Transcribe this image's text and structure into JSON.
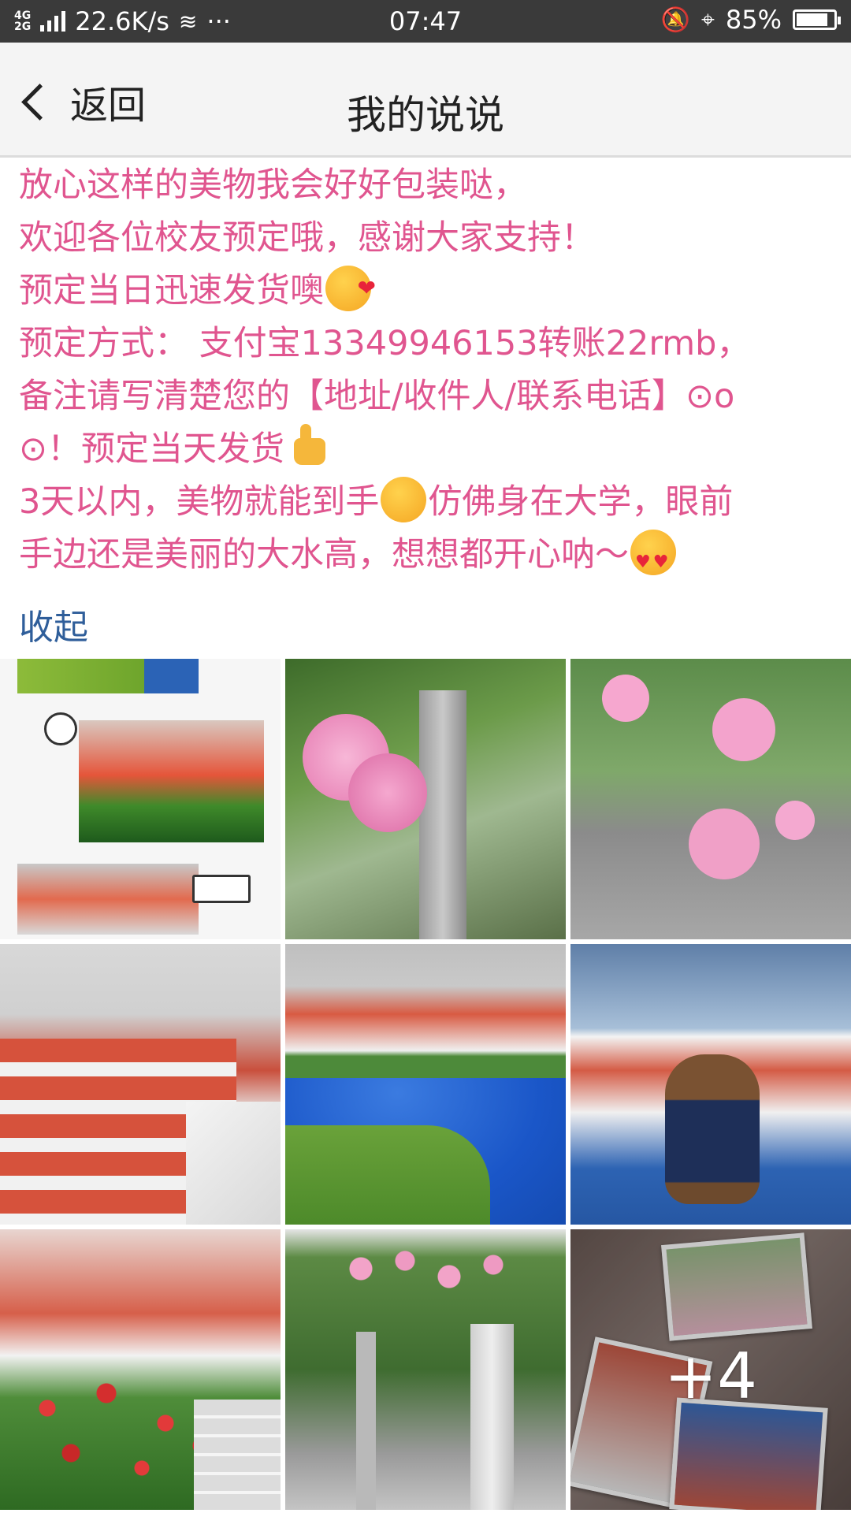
{
  "status_bar": {
    "network": "4G 2G",
    "speed": "22.6K/s",
    "more": "···",
    "time": "07:47",
    "battery_percent": "85%",
    "battery_level": 0.85
  },
  "header": {
    "back_label": "返回",
    "title": "我的说说"
  },
  "post": {
    "line1": "放心这样的美物我会好好包装哒，",
    "line2": "欢迎各位校友预定哦，感谢大家支持！",
    "line3": "预定当日迅速发货噢",
    "line4": "预定方式： 支付宝13349946153转账22rmb，",
    "line5": "备注请写清楚您的【地址/收件人/联系电话】⊙o",
    "line6": "⊙！预定当天发货",
    "line7a": "3天以内，美物就能到手",
    "line7b": "仿佛身在大学，眼前",
    "line8": "手边还是美丽的大水高，想想都开心呐～",
    "emoji1": "kiss-emoji",
    "emoji2": "thumbs-up-emoji",
    "emoji3": "smirk-emoji",
    "emoji4": "heart-eyes-emoji"
  },
  "collapse_label": "收起",
  "photos": {
    "more_count": "+4"
  },
  "colors": {
    "post_text": "#e0558f",
    "link": "#2f5e9a",
    "status_bar_bg": "#3a3a3a",
    "header_bg": "#f4f4f4"
  }
}
